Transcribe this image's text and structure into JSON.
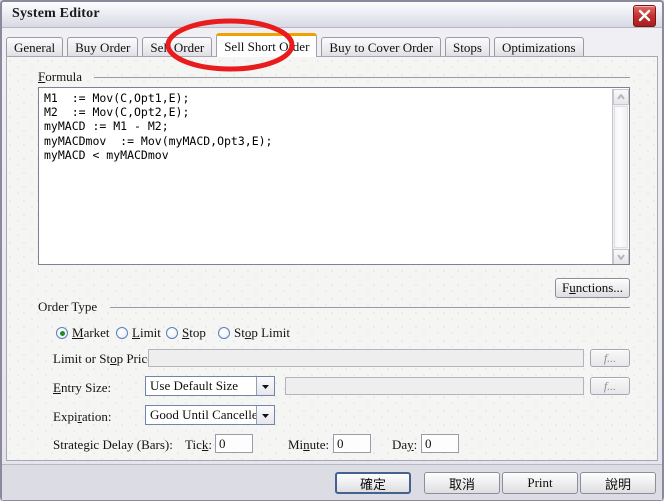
{
  "window": {
    "title": "System Editor",
    "close_icon": "close-x-icon"
  },
  "tabs": [
    {
      "label": "General",
      "active": false
    },
    {
      "label": "Buy Order",
      "active": false
    },
    {
      "label": "Sell Order",
      "active": false
    },
    {
      "label": "Sell Short Order",
      "active": true
    },
    {
      "label": "Buy to Cover Order",
      "active": false
    },
    {
      "label": "Stops",
      "active": false
    },
    {
      "label": "Optimizations",
      "active": false
    }
  ],
  "formula": {
    "group_label_prefix": "F",
    "group_label_rest": "ormula",
    "code": "M1  := Mov(C,Opt1,E);\nM2  := Mov(C,Opt2,E);\nmyMACD := M1 - M2;\nmyMACDmov  := Mov(myMACD,Opt3,E);\nmyMACD < myMACDmov",
    "scroll_up_icon": "chevron-up-icon",
    "scroll_down_icon": "chevron-down-icon"
  },
  "functions_button": {
    "label_prefix": "F",
    "label_mnemonic": "u",
    "label_rest": "nctions..."
  },
  "order_type": {
    "group_label": "Order Type",
    "options": [
      {
        "label_pre": "",
        "mnemonic": "M",
        "label_post": "arket",
        "checked": true
      },
      {
        "label_pre": "",
        "mnemonic": "L",
        "label_post": "imit",
        "checked": false
      },
      {
        "label_pre": "",
        "mnemonic": "S",
        "label_post": "top",
        "checked": false
      },
      {
        "label_pre": "St",
        "mnemonic": "o",
        "label_post": "p Limit",
        "checked": false
      }
    ]
  },
  "fields": {
    "limit_or_stop_price": {
      "label_pre": "Limit or St",
      "label_mnemonic": "o",
      "label_post": "p Price:",
      "value": "",
      "disabled": true,
      "fx_label": "f..."
    },
    "entry_size": {
      "label_mnemonic": "E",
      "label_rest": "ntry Size:",
      "value": "Use Default Size",
      "arrow_icon": "chevron-down-icon",
      "expr_value": "",
      "fx_label": "f..."
    },
    "expiration": {
      "label_pre": "Expi",
      "label_mnemonic": "r",
      "label_post": "ation:",
      "value": "Good Until Cancelled",
      "arrow_icon": "chevron-down-icon"
    },
    "strategic_delay": {
      "label": "Strategic Delay (Bars):",
      "tick": {
        "label_pre": "Tic",
        "label_mnemonic": "k",
        "label_post": ":",
        "value": "0"
      },
      "minute": {
        "label_pre": "Mi",
        "label_mnemonic": "n",
        "label_post": "ute:",
        "value": "0"
      },
      "day": {
        "label_pre": "Da",
        "label_mnemonic": "y",
        "label_post": ":",
        "value": "0"
      }
    }
  },
  "footer": {
    "ok": "確定",
    "cancel": "取消",
    "print": "Print",
    "help": "說明"
  },
  "annotation": {
    "shape": "red-ellipse-highlight",
    "color": "#e81c1c",
    "target": "Sell Short Order"
  }
}
